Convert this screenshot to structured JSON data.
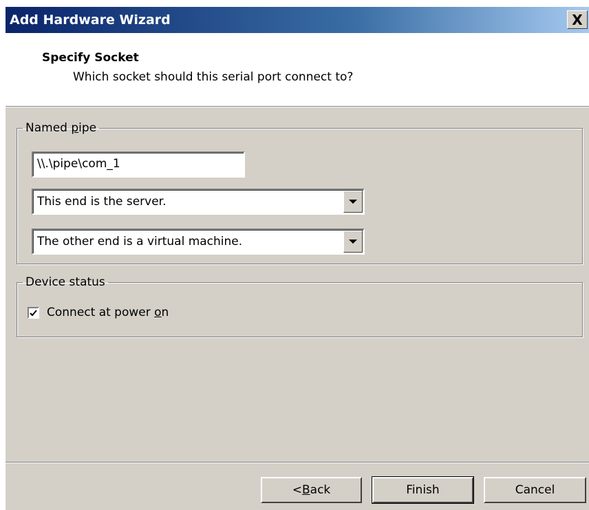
{
  "window": {
    "title": "Add Hardware Wizard",
    "close_label": "X"
  },
  "header": {
    "title": "Specify Socket",
    "subtitle": "Which socket should this serial port connect to?"
  },
  "named_pipe": {
    "legend_prefix": "Named ",
    "legend_mnemonic": "p",
    "legend_suffix": "ipe",
    "pipe_name_value": "\\\\.\\pipe\\com_1",
    "this_end_value": "This end is the server.",
    "other_end_value": "The other end is a virtual machine."
  },
  "device_status": {
    "legend": "Device status",
    "connect_checked": true,
    "connect_prefix": "Connect at power ",
    "connect_mnemonic": "o",
    "connect_suffix": "n"
  },
  "buttons": {
    "back_prefix": "< ",
    "back_mnemonic": "B",
    "back_suffix": "ack",
    "finish": "Finish",
    "cancel": "Cancel"
  }
}
